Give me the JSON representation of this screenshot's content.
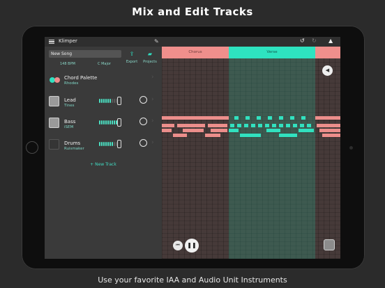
{
  "headline": "Mix and Edit Tracks",
  "caption": "Use your favorite IAA and Audio Unit Instruments",
  "app": {
    "title": "Klimper",
    "song_name": "New Song",
    "tempo": "148 BPM",
    "key": "C Major",
    "export_label": "Export",
    "projects_label": "Projects"
  },
  "tracks": [
    {
      "name": "Chord Palette",
      "instrument": "Rhodes"
    },
    {
      "name": "Lead",
      "instrument": "Tines"
    },
    {
      "name": "Bass",
      "instrument": "iSEM"
    },
    {
      "name": "Drums",
      "instrument": "Ruismaker"
    }
  ],
  "new_track_label": "+ New Track",
  "sections": [
    {
      "label": "Chorus"
    },
    {
      "label": "Verse"
    },
    {
      "label": ""
    }
  ],
  "icons": {
    "menu": "hamburger-icon",
    "edit": "edit-icon",
    "undo": "undo-icon",
    "redo": "redo-icon",
    "cap": "graduation-cap-icon",
    "export": "upload-icon",
    "projects": "folder-icon",
    "speaker": "speaker-icon",
    "rewind": "rewind-icon",
    "pause": "pause-icon"
  },
  "colors": {
    "accent": "#2ee3c0",
    "chorus": "#ef8f8c"
  }
}
